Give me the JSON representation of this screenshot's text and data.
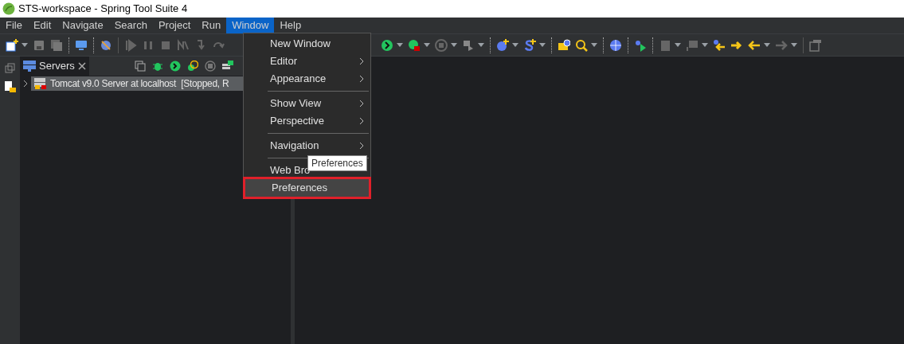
{
  "window": {
    "title": "STS-workspace - Spring Tool Suite 4"
  },
  "menu_bar": [
    {
      "label": "File",
      "selected": false
    },
    {
      "label": "Edit",
      "selected": false
    },
    {
      "label": "Navigate",
      "selected": false
    },
    {
      "label": "Search",
      "selected": false
    },
    {
      "label": "Project",
      "selected": false
    },
    {
      "label": "Run",
      "selected": false
    },
    {
      "label": "Window",
      "selected": true
    },
    {
      "label": "Help",
      "selected": false
    }
  ],
  "servers_view": {
    "tab": "Servers",
    "items": [
      {
        "label": "Tomcat v9.0 Server at localhost  [Stopped, R",
        "expanded": false
      }
    ]
  },
  "window_menu": [
    {
      "kind": "item",
      "label": "New Window",
      "submenu": false,
      "highlighted": false
    },
    {
      "kind": "item",
      "label": "Editor",
      "submenu": true,
      "highlighted": false
    },
    {
      "kind": "item",
      "label": "Appearance",
      "submenu": true,
      "highlighted": false
    },
    {
      "kind": "separator"
    },
    {
      "kind": "item",
      "label": "Show View",
      "submenu": true,
      "highlighted": false
    },
    {
      "kind": "item",
      "label": "Perspective",
      "submenu": true,
      "highlighted": false
    },
    {
      "kind": "separator"
    },
    {
      "kind": "item",
      "label": "Navigation",
      "submenu": true,
      "highlighted": false
    },
    {
      "kind": "separator"
    },
    {
      "kind": "item",
      "label": "Web Bro",
      "submenu": false,
      "highlighted": false
    },
    {
      "kind": "item",
      "label": "Preferences",
      "submenu": false,
      "highlighted": true
    }
  ],
  "tooltip": "Preferences"
}
